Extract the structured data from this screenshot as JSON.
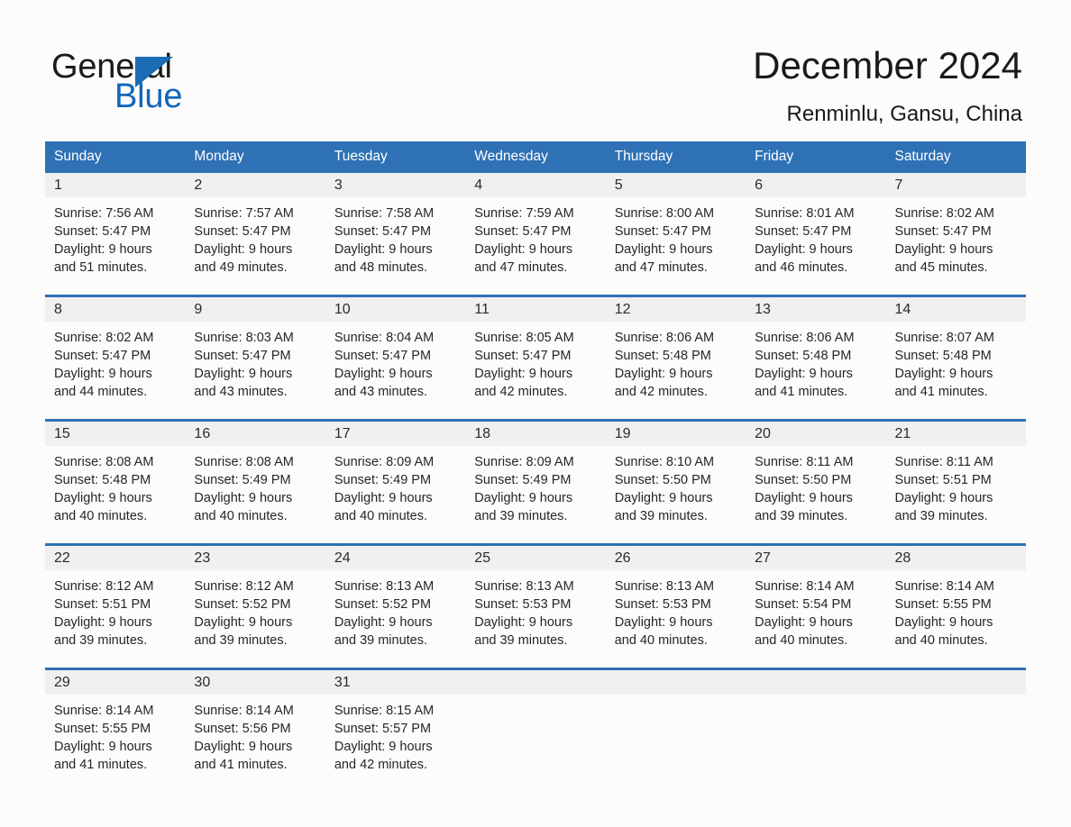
{
  "brand": {
    "name_part1": "General",
    "name_part2": "Blue",
    "triangle_color": "#1b6cb4",
    "blue_text_color": "#1166bb"
  },
  "header": {
    "title": "December 2024",
    "subtitle": "Renminlu, Gansu, China",
    "accent_color": "#2e71b5",
    "band_color": "#f0f0f0"
  },
  "weekday_headers": [
    "Sunday",
    "Monday",
    "Tuesday",
    "Wednesday",
    "Thursday",
    "Friday",
    "Saturday"
  ],
  "weeks": [
    {
      "days": [
        {
          "num": "1",
          "sunrise": "Sunrise: 7:56 AM",
          "sunset": "Sunset: 5:47 PM",
          "daylight_line1": "Daylight: 9 hours",
          "daylight_line2": "and 51 minutes."
        },
        {
          "num": "2",
          "sunrise": "Sunrise: 7:57 AM",
          "sunset": "Sunset: 5:47 PM",
          "daylight_line1": "Daylight: 9 hours",
          "daylight_line2": "and 49 minutes."
        },
        {
          "num": "3",
          "sunrise": "Sunrise: 7:58 AM",
          "sunset": "Sunset: 5:47 PM",
          "daylight_line1": "Daylight: 9 hours",
          "daylight_line2": "and 48 minutes."
        },
        {
          "num": "4",
          "sunrise": "Sunrise: 7:59 AM",
          "sunset": "Sunset: 5:47 PM",
          "daylight_line1": "Daylight: 9 hours",
          "daylight_line2": "and 47 minutes."
        },
        {
          "num": "5",
          "sunrise": "Sunrise: 8:00 AM",
          "sunset": "Sunset: 5:47 PM",
          "daylight_line1": "Daylight: 9 hours",
          "daylight_line2": "and 47 minutes."
        },
        {
          "num": "6",
          "sunrise": "Sunrise: 8:01 AM",
          "sunset": "Sunset: 5:47 PM",
          "daylight_line1": "Daylight: 9 hours",
          "daylight_line2": "and 46 minutes."
        },
        {
          "num": "7",
          "sunrise": "Sunrise: 8:02 AM",
          "sunset": "Sunset: 5:47 PM",
          "daylight_line1": "Daylight: 9 hours",
          "daylight_line2": "and 45 minutes."
        }
      ]
    },
    {
      "days": [
        {
          "num": "8",
          "sunrise": "Sunrise: 8:02 AM",
          "sunset": "Sunset: 5:47 PM",
          "daylight_line1": "Daylight: 9 hours",
          "daylight_line2": "and 44 minutes."
        },
        {
          "num": "9",
          "sunrise": "Sunrise: 8:03 AM",
          "sunset": "Sunset: 5:47 PM",
          "daylight_line1": "Daylight: 9 hours",
          "daylight_line2": "and 43 minutes."
        },
        {
          "num": "10",
          "sunrise": "Sunrise: 8:04 AM",
          "sunset": "Sunset: 5:47 PM",
          "daylight_line1": "Daylight: 9 hours",
          "daylight_line2": "and 43 minutes."
        },
        {
          "num": "11",
          "sunrise": "Sunrise: 8:05 AM",
          "sunset": "Sunset: 5:47 PM",
          "daylight_line1": "Daylight: 9 hours",
          "daylight_line2": "and 42 minutes."
        },
        {
          "num": "12",
          "sunrise": "Sunrise: 8:06 AM",
          "sunset": "Sunset: 5:48 PM",
          "daylight_line1": "Daylight: 9 hours",
          "daylight_line2": "and 42 minutes."
        },
        {
          "num": "13",
          "sunrise": "Sunrise: 8:06 AM",
          "sunset": "Sunset: 5:48 PM",
          "daylight_line1": "Daylight: 9 hours",
          "daylight_line2": "and 41 minutes."
        },
        {
          "num": "14",
          "sunrise": "Sunrise: 8:07 AM",
          "sunset": "Sunset: 5:48 PM",
          "daylight_line1": "Daylight: 9 hours",
          "daylight_line2": "and 41 minutes."
        }
      ]
    },
    {
      "days": [
        {
          "num": "15",
          "sunrise": "Sunrise: 8:08 AM",
          "sunset": "Sunset: 5:48 PM",
          "daylight_line1": "Daylight: 9 hours",
          "daylight_line2": "and 40 minutes."
        },
        {
          "num": "16",
          "sunrise": "Sunrise: 8:08 AM",
          "sunset": "Sunset: 5:49 PM",
          "daylight_line1": "Daylight: 9 hours",
          "daylight_line2": "and 40 minutes."
        },
        {
          "num": "17",
          "sunrise": "Sunrise: 8:09 AM",
          "sunset": "Sunset: 5:49 PM",
          "daylight_line1": "Daylight: 9 hours",
          "daylight_line2": "and 40 minutes."
        },
        {
          "num": "18",
          "sunrise": "Sunrise: 8:09 AM",
          "sunset": "Sunset: 5:49 PM",
          "daylight_line1": "Daylight: 9 hours",
          "daylight_line2": "and 39 minutes."
        },
        {
          "num": "19",
          "sunrise": "Sunrise: 8:10 AM",
          "sunset": "Sunset: 5:50 PM",
          "daylight_line1": "Daylight: 9 hours",
          "daylight_line2": "and 39 minutes."
        },
        {
          "num": "20",
          "sunrise": "Sunrise: 8:11 AM",
          "sunset": "Sunset: 5:50 PM",
          "daylight_line1": "Daylight: 9 hours",
          "daylight_line2": "and 39 minutes."
        },
        {
          "num": "21",
          "sunrise": "Sunrise: 8:11 AM",
          "sunset": "Sunset: 5:51 PM",
          "daylight_line1": "Daylight: 9 hours",
          "daylight_line2": "and 39 minutes."
        }
      ]
    },
    {
      "days": [
        {
          "num": "22",
          "sunrise": "Sunrise: 8:12 AM",
          "sunset": "Sunset: 5:51 PM",
          "daylight_line1": "Daylight: 9 hours",
          "daylight_line2": "and 39 minutes."
        },
        {
          "num": "23",
          "sunrise": "Sunrise: 8:12 AM",
          "sunset": "Sunset: 5:52 PM",
          "daylight_line1": "Daylight: 9 hours",
          "daylight_line2": "and 39 minutes."
        },
        {
          "num": "24",
          "sunrise": "Sunrise: 8:13 AM",
          "sunset": "Sunset: 5:52 PM",
          "daylight_line1": "Daylight: 9 hours",
          "daylight_line2": "and 39 minutes."
        },
        {
          "num": "25",
          "sunrise": "Sunrise: 8:13 AM",
          "sunset": "Sunset: 5:53 PM",
          "daylight_line1": "Daylight: 9 hours",
          "daylight_line2": "and 39 minutes."
        },
        {
          "num": "26",
          "sunrise": "Sunrise: 8:13 AM",
          "sunset": "Sunset: 5:53 PM",
          "daylight_line1": "Daylight: 9 hours",
          "daylight_line2": "and 40 minutes."
        },
        {
          "num": "27",
          "sunrise": "Sunrise: 8:14 AM",
          "sunset": "Sunset: 5:54 PM",
          "daylight_line1": "Daylight: 9 hours",
          "daylight_line2": "and 40 minutes."
        },
        {
          "num": "28",
          "sunrise": "Sunrise: 8:14 AM",
          "sunset": "Sunset: 5:55 PM",
          "daylight_line1": "Daylight: 9 hours",
          "daylight_line2": "and 40 minutes."
        }
      ]
    },
    {
      "days": [
        {
          "num": "29",
          "sunrise": "Sunrise: 8:14 AM",
          "sunset": "Sunset: 5:55 PM",
          "daylight_line1": "Daylight: 9 hours",
          "daylight_line2": "and 41 minutes."
        },
        {
          "num": "30",
          "sunrise": "Sunrise: 8:14 AM",
          "sunset": "Sunset: 5:56 PM",
          "daylight_line1": "Daylight: 9 hours",
          "daylight_line2": "and 41 minutes."
        },
        {
          "num": "31",
          "sunrise": "Sunrise: 8:15 AM",
          "sunset": "Sunset: 5:57 PM",
          "daylight_line1": "Daylight: 9 hours",
          "daylight_line2": "and 42 minutes."
        },
        {
          "num": "",
          "sunrise": "",
          "sunset": "",
          "daylight_line1": "",
          "daylight_line2": ""
        },
        {
          "num": "",
          "sunrise": "",
          "sunset": "",
          "daylight_line1": "",
          "daylight_line2": ""
        },
        {
          "num": "",
          "sunrise": "",
          "sunset": "",
          "daylight_line1": "",
          "daylight_line2": ""
        },
        {
          "num": "",
          "sunrise": "",
          "sunset": "",
          "daylight_line1": "",
          "daylight_line2": ""
        }
      ]
    }
  ]
}
